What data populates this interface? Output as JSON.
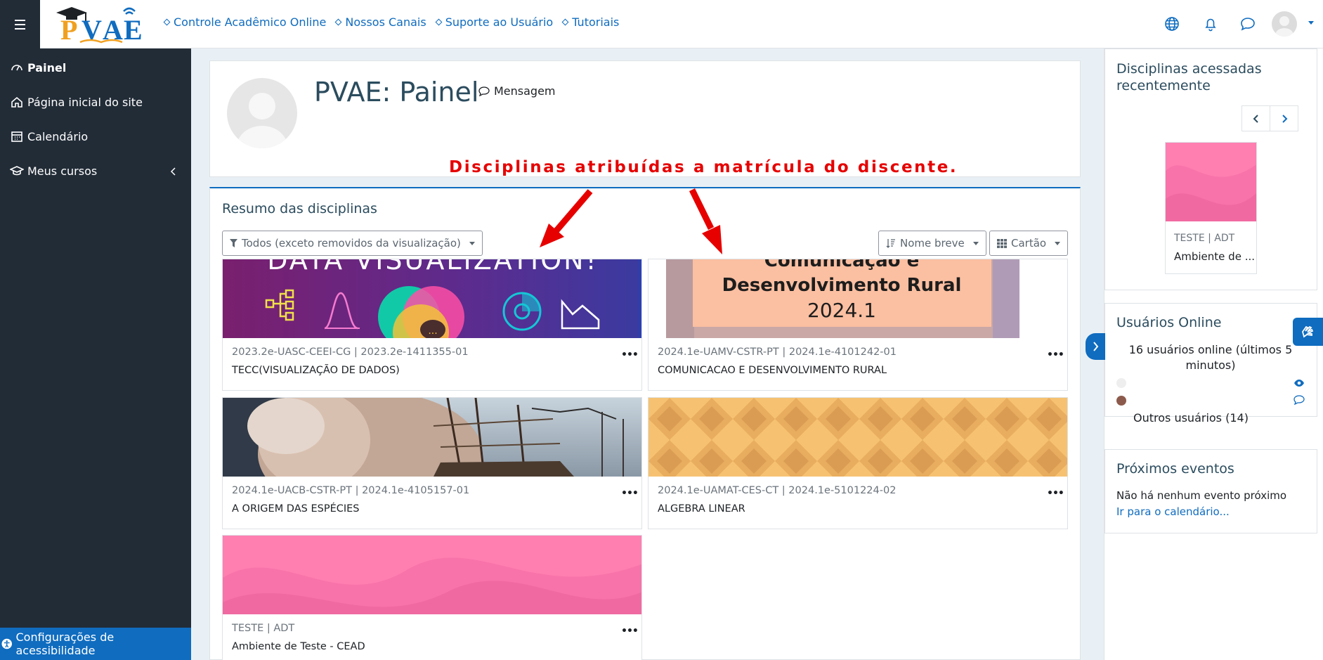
{
  "navbar": {
    "logo_text": "PVAE",
    "links": [
      {
        "label": "Controle Acadêmico Online"
      },
      {
        "label": "Nossos Canais"
      },
      {
        "label": "Suporte ao Usuário"
      },
      {
        "label": "Tutoriais"
      }
    ],
    "icons": [
      "globe-icon",
      "bell-icon",
      "chat-icon",
      "user-avatar"
    ]
  },
  "drawer": {
    "items": [
      {
        "label": "Painel",
        "icon": "dashboard-icon",
        "active": true
      },
      {
        "label": "Página inicial do site",
        "icon": "home-icon"
      },
      {
        "label": "Calendário",
        "icon": "calendar-icon"
      },
      {
        "label": "Meus cursos",
        "icon": "graduation-cap-icon"
      }
    ],
    "accessibility_label": "Configurações de acessibilidade"
  },
  "header": {
    "title": "PVAE: Painel",
    "message_label": "Mensagem"
  },
  "annotation": {
    "text": "Disciplinas atribuídas a matrícula do discente."
  },
  "courses": {
    "title": "Resumo das disciplinas",
    "filter_label": "Todos (exceto removidos da visualização)",
    "sort_label": "Nome breve",
    "view_label": "Cartão",
    "items": [
      {
        "category": "2023.2e-UASC-CEEI-CG | 2023.2e-1411355-01",
        "name": "TECC(VISUALIZAÇÃO DE DADOS)",
        "image_text": "DATA VISUALIZATION!",
        "image": "data-visualization"
      },
      {
        "category": "2024.1e-UAMV-CSTR-PT | 2024.1e-4101242-01",
        "name": "COMUNICACAO E DESENVOLVIMENTO RURAL",
        "image_lines": [
          "Comunicação e",
          "Desenvolvimento Rural",
          "2024.1"
        ],
        "image": "rural-communication"
      },
      {
        "category": "2024.1e-UACB-CSTR-PT | 2024.1e-4105157-01",
        "name": "A ORIGEM DAS ESPÉCIES",
        "image": "darwin-ship"
      },
      {
        "category": "2024.1e-UAMAT-CES-CT | 2024.1e-5101224-02",
        "name": "ALGEBRA LINEAR",
        "image": "orange-diamond-pattern"
      },
      {
        "category": "TESTE | ADT",
        "name": "Ambiente de Teste - CEAD",
        "image": "pink-wave-pattern"
      }
    ]
  },
  "recent_courses": {
    "title": "Disciplinas acessadas recentemente",
    "card": {
      "category": "TESTE | ADT",
      "name": "Ambiente de ..."
    }
  },
  "online_users": {
    "title": "Usuários Online",
    "summary": "16 usuários online (últimos 5 minutos)",
    "others": "Outros usuários (14)"
  },
  "events": {
    "title": "Próximos eventos",
    "empty_text": "Não há nenhum evento próximo",
    "calendar_link": "Ir para o calendário..."
  },
  "colors": {
    "accent": "#0f6cbf",
    "drawer_bg": "#222c37",
    "annotation": "#e60000",
    "title": "#2b4c5e"
  }
}
